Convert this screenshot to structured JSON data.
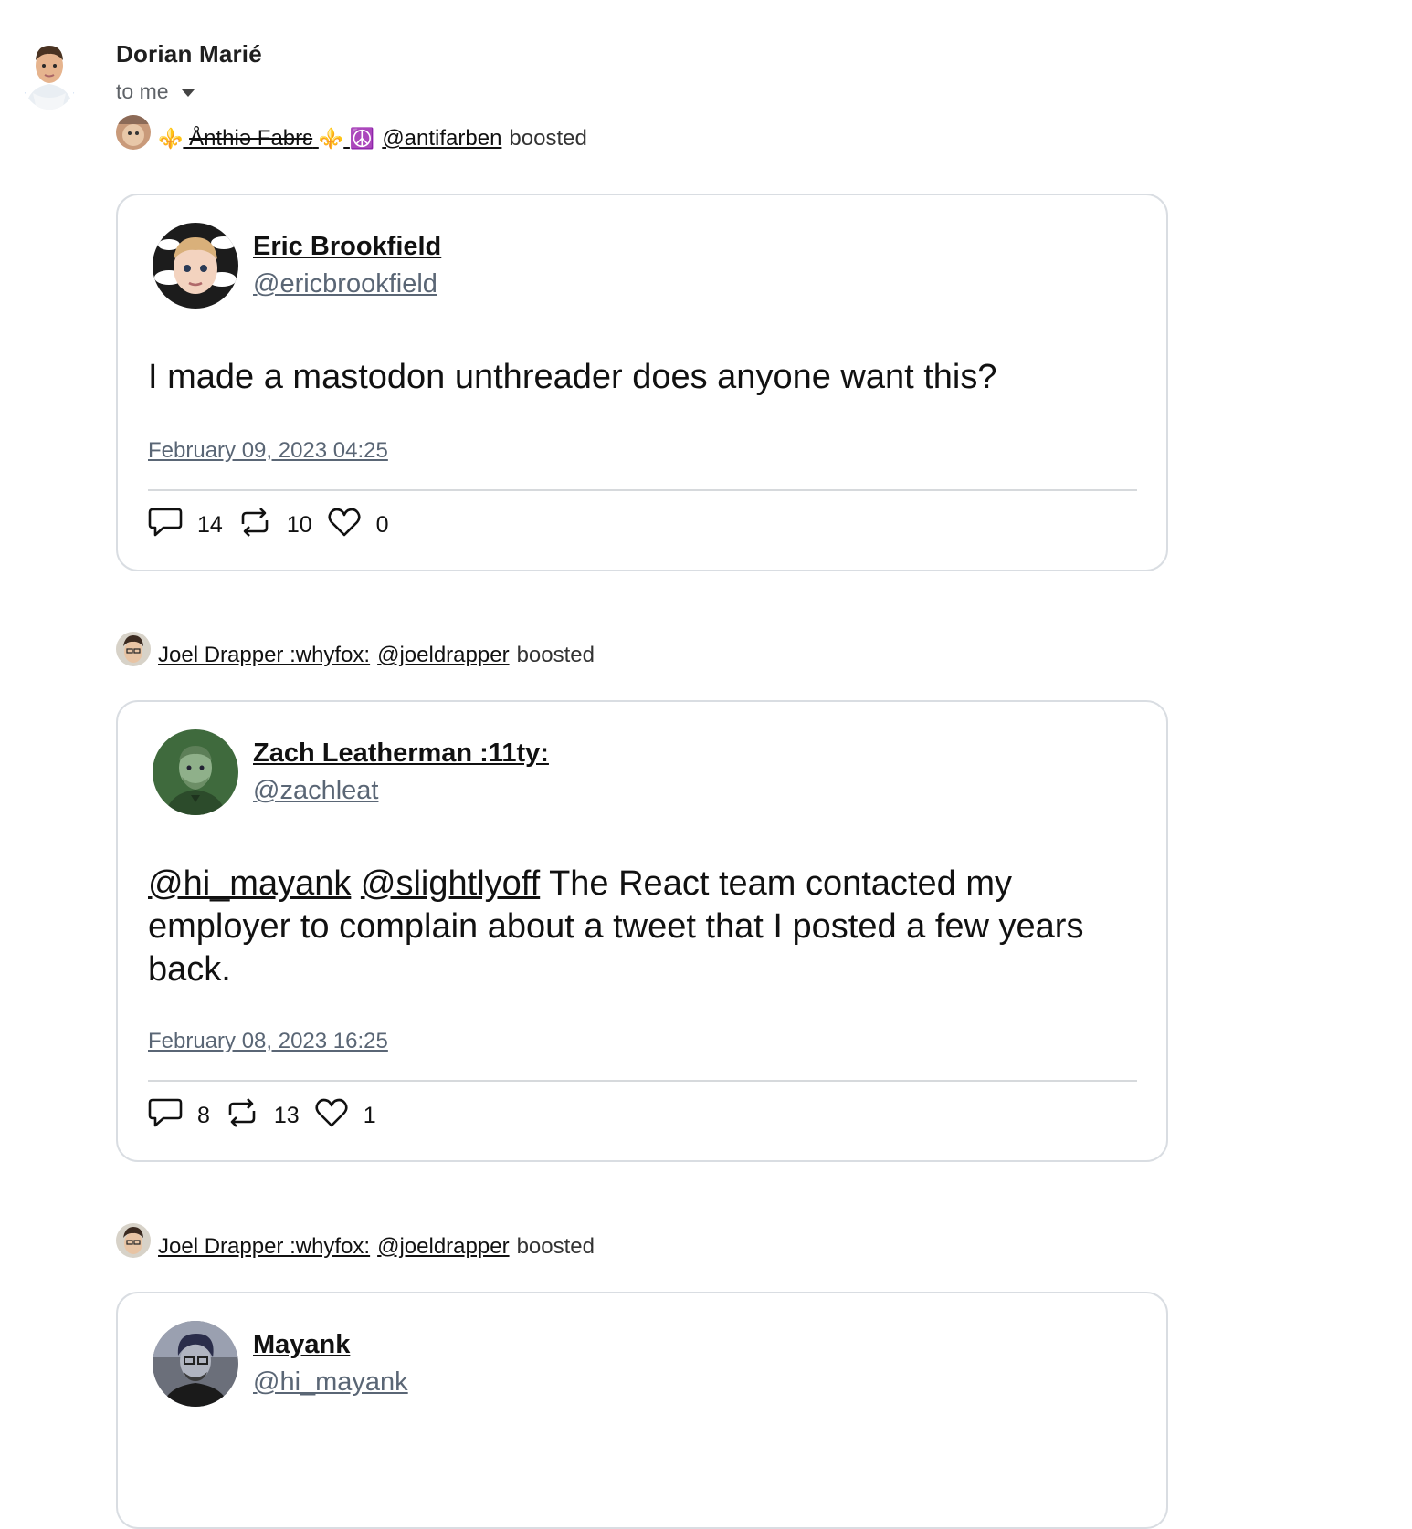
{
  "email": {
    "sender_name": "Dorian Marié",
    "to_label": "to me"
  },
  "boosts": [
    {
      "booster_name": "Ånthiə Fabrɛ",
      "booster_prefix_emoji": "⚜️",
      "booster_suffix_emoji": "⚜️",
      "booster_extra_emoji": "☮️",
      "booster_handle": "@antifarben",
      "boosted_label": "boosted",
      "post": {
        "author_name": "Eric Brookfield",
        "author_handle": "@ericbrookfield",
        "text": "I made a mastodon unthreader does anyone want this?",
        "timestamp": "February 09, 2023 04:25",
        "replies": "14",
        "boosts": "10",
        "favourites": "0"
      }
    },
    {
      "booster_name": "Joel Drapper :whyfox:",
      "booster_handle": "@joeldrapper",
      "boosted_label": "boosted",
      "post": {
        "author_name": "Zach Leatherman :11ty:",
        "author_handle": "@zachleat",
        "mention_1": "@hi_mayank",
        "mention_2": "@slightlyoff",
        "text": "The React team contacted my employer to complain about a tweet that I posted a few years back.",
        "timestamp": "February 08, 2023 16:25",
        "replies": "8",
        "boosts": "13",
        "favourites": "1"
      }
    },
    {
      "booster_name": "Joel Drapper :whyfox:",
      "booster_handle": "@joeldrapper",
      "boosted_label": "boosted",
      "post": {
        "author_name": "Mayank",
        "author_handle": "@hi_mayank"
      }
    }
  ],
  "icons": {
    "reply": "speech-bubble-icon",
    "boost": "boost-arrows-icon",
    "favourite": "heart-icon"
  }
}
